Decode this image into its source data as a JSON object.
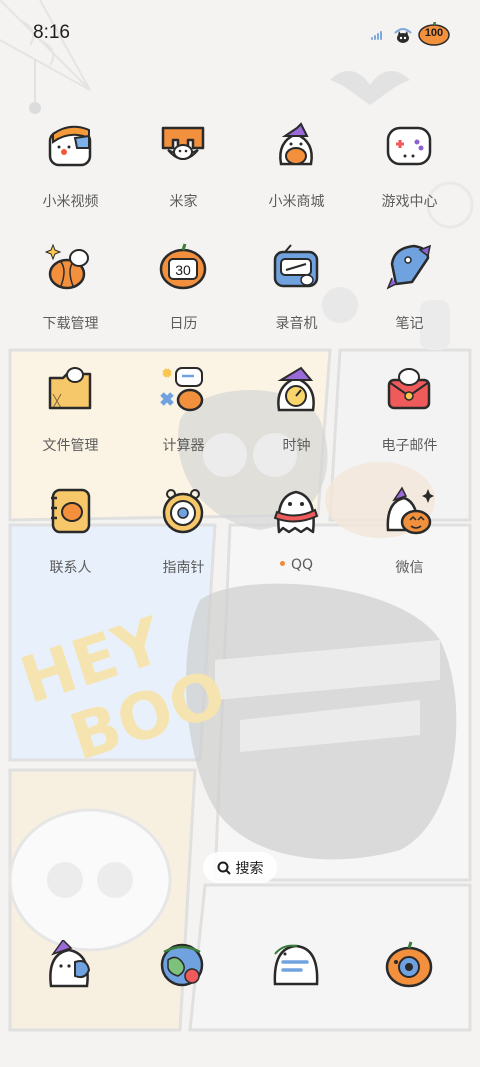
{
  "status_bar": {
    "time": "8:16",
    "battery": "100"
  },
  "apps": [
    {
      "name": "小米视频"
    },
    {
      "name": "米家"
    },
    {
      "name": "小米商城"
    },
    {
      "name": "游戏中心"
    },
    {
      "name": "下载管理"
    },
    {
      "name": "日历",
      "icon_text": "30"
    },
    {
      "name": "录音机"
    },
    {
      "name": "笔记"
    },
    {
      "name": "文件管理"
    },
    {
      "name": "计算器"
    },
    {
      "name": "时钟"
    },
    {
      "name": "电子邮件"
    },
    {
      "name": "联系人"
    },
    {
      "name": "指南针"
    },
    {
      "name": "QQ"
    },
    {
      "name": "微信"
    }
  ],
  "search": {
    "label": "搜索"
  },
  "dock": [
    {
      "icon": "ghost-phone-icon"
    },
    {
      "icon": "globe-browser-icon"
    },
    {
      "icon": "ghost-message-icon"
    },
    {
      "icon": "pumpkin-camera-icon"
    }
  ]
}
